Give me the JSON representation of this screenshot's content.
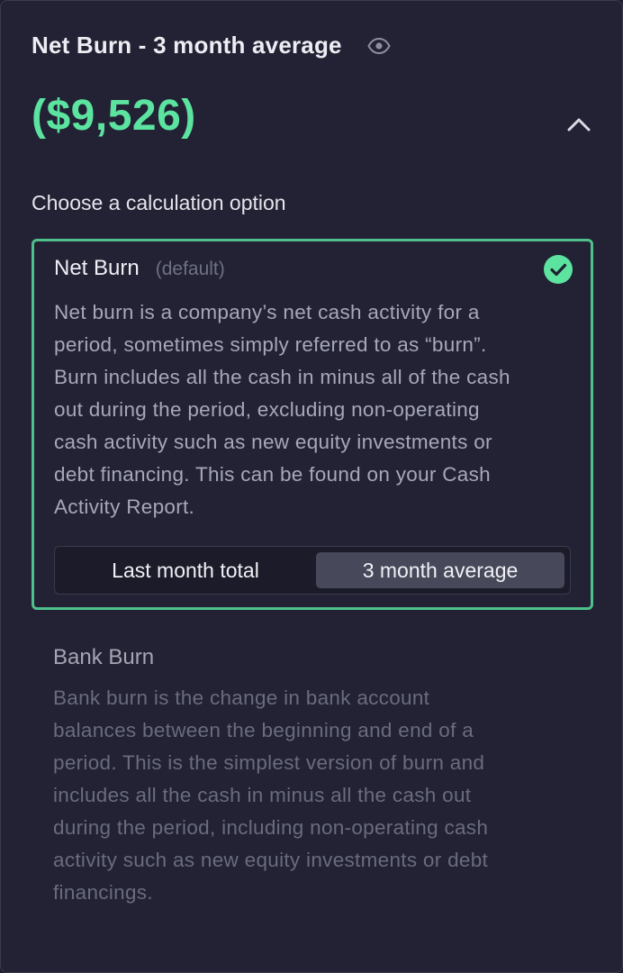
{
  "header": {
    "title": "Net Burn - 3 month average",
    "eye_icon": "eye-icon"
  },
  "amount": "($9,526)",
  "collapse_icon": "chevron-up-icon",
  "choose_label": "Choose a calculation option",
  "options": [
    {
      "title": "Net Burn",
      "tag": "(default)",
      "selected": true,
      "description_lines": [
        "Net burn is a company’s net cash activity for a",
        "period, sometimes simply referred to as “burn”.",
        "Burn includes all the cash in minus all of the cash",
        "out during the period, excluding non-operating",
        "cash activity such as new equity investments or",
        "debt financing.  This can be found on your Cash",
        "Activity Report."
      ],
      "period_toggle": {
        "options": [
          "Last month total",
          "3 month average"
        ],
        "selected": "3 month average"
      }
    },
    {
      "title": "Bank Burn",
      "selected": false,
      "description_lines": [
        "Bank burn is the change in bank account",
        "balances between the beginning and end of a",
        "period. This is the simplest version of burn and",
        "includes all the cash in minus all the cash out",
        "during the period, including non-operating cash",
        "activity such as new equity investments or debt",
        "financings."
      ]
    }
  ],
  "colors": {
    "accent": "#5ce3a0",
    "selected_border": "#4fbf8c",
    "panel_bg": "#222234",
    "segment_active_bg": "#474859"
  }
}
